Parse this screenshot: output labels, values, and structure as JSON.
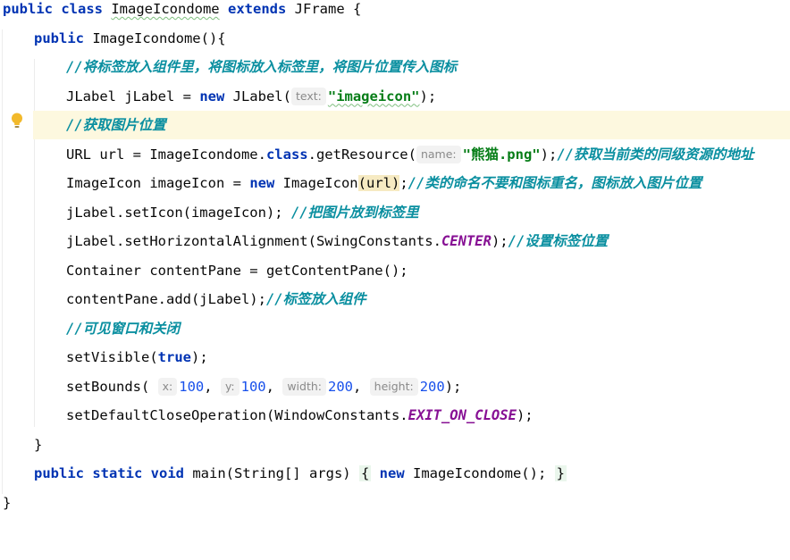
{
  "editor": {
    "lines": [
      {
        "indent": 0,
        "tokens": [
          {
            "t": "public ",
            "c": "kw"
          },
          {
            "t": "class ",
            "c": "kw"
          },
          {
            "t": "ImageIcondome",
            "c": "squig"
          },
          {
            "t": " "
          },
          {
            "t": "extends ",
            "c": "kw"
          },
          {
            "t": "JFrame {"
          }
        ]
      },
      {
        "indent": 1,
        "tokens": [
          {
            "t": "public ",
            "c": "kw"
          },
          {
            "t": "ImageIcondome(){"
          }
        ]
      },
      {
        "indent": 2,
        "tokens": [
          {
            "t": "//将标签放入组件里，将图标放入标签里，将图片位置传入图标",
            "c": "cmt"
          }
        ]
      },
      {
        "indent": 2,
        "tokens": [
          {
            "t": "JLabel jLabel = "
          },
          {
            "t": "new ",
            "c": "kw"
          },
          {
            "t": "JLabel("
          },
          {
            "t": "text:",
            "c": "hint"
          },
          {
            "t": "\"imageicon\"",
            "c": "str squig"
          },
          {
            "t": ");"
          }
        ]
      },
      {
        "indent": 2,
        "current": true,
        "tokens": [
          {
            "t": "//获取图片位置",
            "c": "cmt"
          }
        ]
      },
      {
        "indent": 2,
        "tokens": [
          {
            "t": "URL url = ImageIcondome."
          },
          {
            "t": "class",
            "c": "kw"
          },
          {
            "t": ".getResource("
          },
          {
            "t": "name:",
            "c": "hint"
          },
          {
            "t": "\"熊猫.png\"",
            "c": "str"
          },
          {
            "t": ");"
          },
          {
            "t": "//获取当前类的同级资源的地址",
            "c": "cmt"
          }
        ]
      },
      {
        "indent": 2,
        "tokens": [
          {
            "t": "ImageIcon imageIcon = "
          },
          {
            "t": "new ",
            "c": "kw"
          },
          {
            "t": "ImageIcon"
          },
          {
            "t": "(",
            "c": "match"
          },
          {
            "t": "url",
            "c": "match"
          },
          {
            "t": ")",
            "c": "match"
          },
          {
            "t": ";"
          },
          {
            "t": "//类的命名不要和图标重名，图标放入图片位置",
            "c": "cmt"
          }
        ]
      },
      {
        "indent": 2,
        "tokens": [
          {
            "t": "jLabel.setIcon(imageIcon); "
          },
          {
            "t": "//把图片放到标签里",
            "c": "cmt"
          }
        ]
      },
      {
        "indent": 2,
        "tokens": [
          {
            "t": "jLabel.setHorizontalAlignment(SwingConstants."
          },
          {
            "t": "CENTER",
            "c": "const"
          },
          {
            "t": ");"
          },
          {
            "t": "//设置标签位置",
            "c": "cmt"
          }
        ]
      },
      {
        "indent": 2,
        "tokens": [
          {
            "t": "Container contentPane = getContentPane();"
          }
        ]
      },
      {
        "indent": 2,
        "tokens": [
          {
            "t": "contentPane.add(jLabel);"
          },
          {
            "t": "//标签放入组件",
            "c": "cmt"
          }
        ]
      },
      {
        "indent": 2,
        "tokens": [
          {
            "t": "//可见窗口和关闭",
            "c": "cmt"
          }
        ]
      },
      {
        "indent": 2,
        "tokens": [
          {
            "t": "setVisible("
          },
          {
            "t": "true",
            "c": "kw"
          },
          {
            "t": ");"
          }
        ]
      },
      {
        "indent": 2,
        "tokens": [
          {
            "t": "setBounds( "
          },
          {
            "t": "x:",
            "c": "hint"
          },
          {
            "t": "100",
            "c": "num"
          },
          {
            "t": ", "
          },
          {
            "t": "y:",
            "c": "hint"
          },
          {
            "t": "100",
            "c": "num"
          },
          {
            "t": ", "
          },
          {
            "t": "width:",
            "c": "hint"
          },
          {
            "t": "200",
            "c": "num"
          },
          {
            "t": ", "
          },
          {
            "t": "height:",
            "c": "hint"
          },
          {
            "t": "200",
            "c": "num"
          },
          {
            "t": ");"
          }
        ]
      },
      {
        "indent": 2,
        "tokens": [
          {
            "t": "setDefaultCloseOperation(WindowConstants."
          },
          {
            "t": "EXIT_ON_CLOSE",
            "c": "const"
          },
          {
            "t": ");"
          }
        ]
      },
      {
        "indent": 1,
        "tokens": [
          {
            "t": "}"
          }
        ]
      },
      {
        "indent": 1,
        "tokens": [
          {
            "t": "public ",
            "c": "kw"
          },
          {
            "t": "static ",
            "c": "kw"
          },
          {
            "t": "void ",
            "c": "kw"
          },
          {
            "t": "main(String[] args) "
          },
          {
            "t": "{",
            "c": "fold"
          },
          {
            "t": " "
          },
          {
            "t": "new ",
            "c": "kw"
          },
          {
            "t": "ImageIcondome(); "
          },
          {
            "t": "}",
            "c": "fold"
          }
        ]
      },
      {
        "indent": 0,
        "tokens": [
          {
            "t": "}"
          }
        ]
      }
    ]
  },
  "gutter": {
    "intention_icon": "lightbulb-icon"
  },
  "colors": {
    "keyword": "#0033b3",
    "string": "#067d17",
    "comment": "#0a8fa0",
    "number": "#1750eb",
    "constant": "#871094",
    "current_line": "#fdf8df"
  }
}
